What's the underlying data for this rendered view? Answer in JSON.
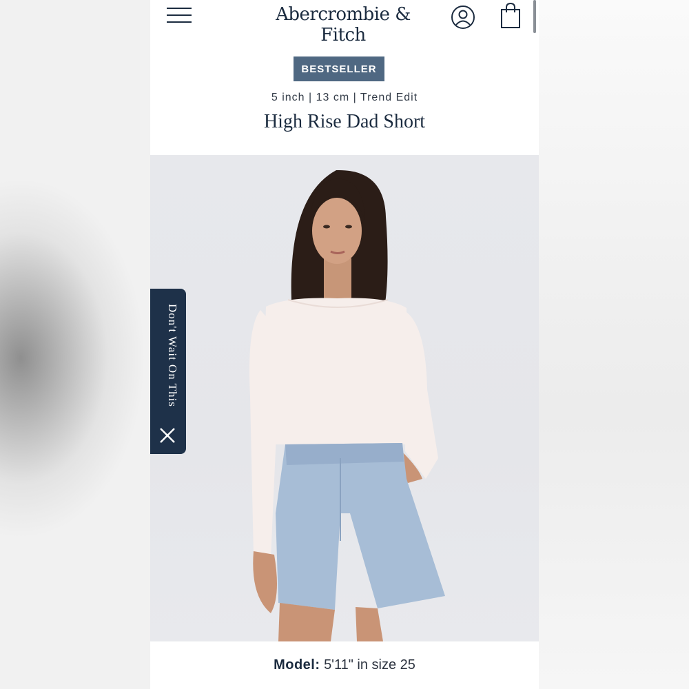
{
  "header": {
    "brand": "Abercrombie & Fitch",
    "menu_icon": "hamburger-menu-icon",
    "account_icon": "account-icon",
    "bag_icon": "shopping-bag-icon"
  },
  "product": {
    "badge": "BESTSELLER",
    "subtitle": "5 inch | 13 cm | Trend Edit",
    "title": "High Rise Dad Short"
  },
  "promo": {
    "label": "Don't Wait On This",
    "close_icon": "close-icon"
  },
  "model": {
    "label": "Model:",
    "details": "5'11\" in size 25"
  },
  "colors": {
    "brand_navy": "#1b2b3f",
    "badge_bg": "#4f6882",
    "promo_bg": "#1e3149"
  }
}
